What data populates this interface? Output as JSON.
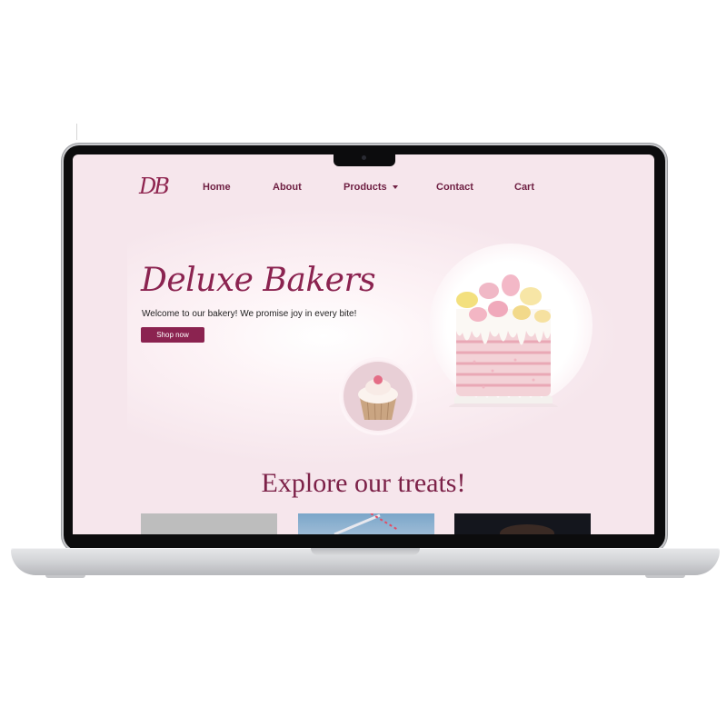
{
  "site": {
    "logo": "DB",
    "nav": {
      "home": "Home",
      "about": "About",
      "products": "Products",
      "contact": "Contact",
      "cart": "Cart"
    },
    "hero": {
      "title": "Deluxe Bakers",
      "subtitle": "Welcome to our bakery!  We promise joy in every bite!",
      "cta": "Shop now"
    },
    "section_title": "Explore our treats!"
  },
  "colors": {
    "brand": "#8b2350",
    "background": "#f6e6ec",
    "laptop_frame": "#0c0c0d"
  }
}
